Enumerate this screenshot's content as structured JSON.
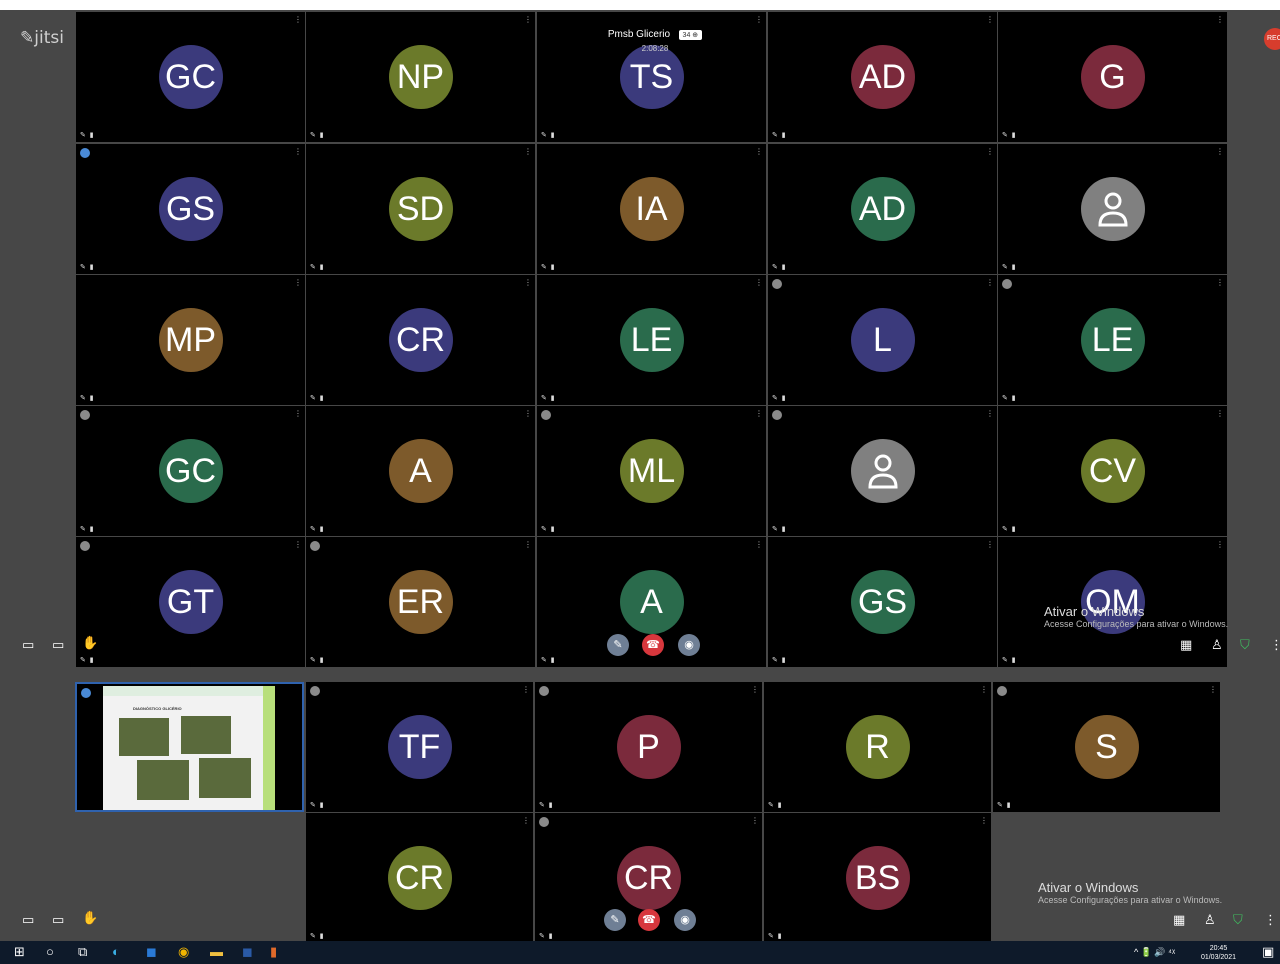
{
  "app": {
    "logo": "jitsi",
    "rec": "REC"
  },
  "meeting": {
    "name": "Pmsb Glicerio",
    "participants": "34",
    "duration": "2:08:28"
  },
  "colors": {
    "blue": "#3b3a7c",
    "olive": "#6b7a2a",
    "brown": "#7d5a2b",
    "maroon": "#7b2a3c",
    "green": "#2a6b4c",
    "gray": "#808080"
  },
  "top_grid": [
    {
      "i": "GC",
      "c": "blue"
    },
    {
      "i": "NP",
      "c": "olive"
    },
    {
      "i": "TS",
      "c": "blue"
    },
    {
      "i": "AD",
      "c": "maroon"
    },
    {
      "i": "G",
      "c": "maroon"
    },
    {
      "i": "GS",
      "c": "blue",
      "b": "blue"
    },
    {
      "i": "SD",
      "c": "olive"
    },
    {
      "i": "IA",
      "c": "brown"
    },
    {
      "i": "AD",
      "c": "green"
    },
    {
      "i": "",
      "c": "gray",
      "p": true
    },
    {
      "i": "MP",
      "c": "brown"
    },
    {
      "i": "CR",
      "c": "blue"
    },
    {
      "i": "LE",
      "c": "green"
    },
    {
      "i": "L",
      "c": "blue",
      "b": "gray"
    },
    {
      "i": "LE",
      "c": "green",
      "b": "gray"
    },
    {
      "i": "GC",
      "c": "green",
      "b": "gray"
    },
    {
      "i": "A",
      "c": "brown"
    },
    {
      "i": "ML",
      "c": "olive",
      "b": "gray"
    },
    {
      "i": "",
      "c": "gray",
      "p": true,
      "b": "gray"
    },
    {
      "i": "CV",
      "c": "olive"
    },
    {
      "i": "GT",
      "c": "blue",
      "b": "gray"
    },
    {
      "i": "ER",
      "c": "brown",
      "b": "gray"
    },
    {
      "i": "A",
      "c": "green"
    },
    {
      "i": "GS",
      "c": "green"
    },
    {
      "i": "OM",
      "c": "blue"
    }
  ],
  "bottom_grid": [
    {
      "i": "TF",
      "c": "blue",
      "b": "gray"
    },
    {
      "i": "P",
      "c": "maroon",
      "b": "gray"
    },
    {
      "i": "R",
      "c": "olive"
    },
    {
      "i": "S",
      "c": "brown",
      "b": "gray"
    },
    {
      "i": "CR",
      "c": "olive"
    },
    {
      "i": "CR",
      "c": "maroon",
      "b": "gray"
    },
    {
      "i": "BS",
      "c": "maroon"
    }
  ],
  "slide": {
    "title": "DIAGNÓSTICO GLICÉRIO"
  },
  "activate": {
    "title": "Ativar o Windows",
    "subtitle": "Acesse Configurações para ativar o Windows."
  },
  "clock": {
    "time": "20:45",
    "date": "01/03/2021"
  },
  "tray": "^  🔋 🔊 ⁴ᵡ"
}
